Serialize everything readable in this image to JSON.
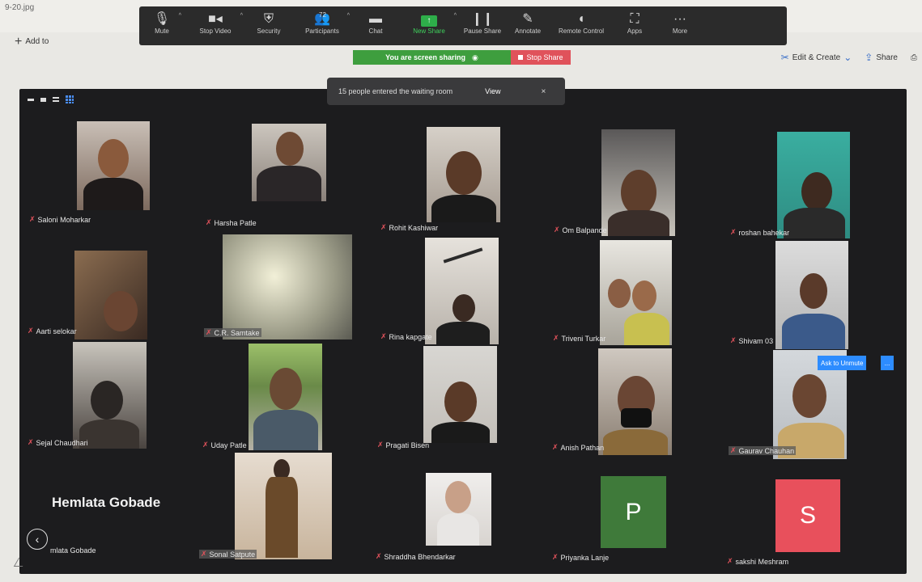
{
  "viewer": {
    "filename": "9-20.jpg",
    "add_to": "Add to",
    "edit_create": "Edit & Create",
    "share": "Share"
  },
  "toolbar": {
    "mute": "Mute",
    "stop_video": "Stop Video",
    "security": "Security",
    "participants": "Participants",
    "participants_count": "72",
    "chat": "Chat",
    "new_share": "New Share",
    "pause_share": "Pause Share",
    "annotate": "Annotate",
    "remote_control": "Remote Control",
    "apps": "Apps",
    "more": "More"
  },
  "share_bar": {
    "sharing_text": "You are screen sharing",
    "stop_share": "Stop Share"
  },
  "waiting_room": {
    "message": "15 people entered the waiting room",
    "view": "View",
    "close": "×"
  },
  "speaker": {
    "big_name": "Hemlata Gobade",
    "label": "mlata Gobade"
  },
  "ask_to_unmute": "Ask to Unmute",
  "ask_more": "...",
  "participants": [
    {
      "name": "Saloni Moharkar"
    },
    {
      "name": "Harsha Patle"
    },
    {
      "name": "Rohit Kashiwar"
    },
    {
      "name": "Om Balpande"
    },
    {
      "name": "roshan bahekar"
    },
    {
      "name": "Aarti selokar"
    },
    {
      "name": "C.R. Samtake"
    },
    {
      "name": "Rina kapgate"
    },
    {
      "name": "Triveni Turkar"
    },
    {
      "name": "Shivam 03"
    },
    {
      "name": "Sejal Chaudhari"
    },
    {
      "name": "Uday Patle"
    },
    {
      "name": "Pragati Bisen"
    },
    {
      "name": "Anish Pathan"
    },
    {
      "name": "Gaurav Chauhan"
    },
    {
      "name": "Sonal Satpute"
    },
    {
      "name": "Shraddha Bhendarkar"
    },
    {
      "name": "Priyanka Lanje",
      "initial": "P"
    },
    {
      "name": "sakshi Meshram",
      "initial": "S"
    }
  ],
  "colors": {
    "accent_blue": "#2d8cff",
    "share_green": "#3e9e3e",
    "stop_red": "#e0525b",
    "tile_p": "#3f7a3a",
    "tile_s": "#e8505c"
  }
}
